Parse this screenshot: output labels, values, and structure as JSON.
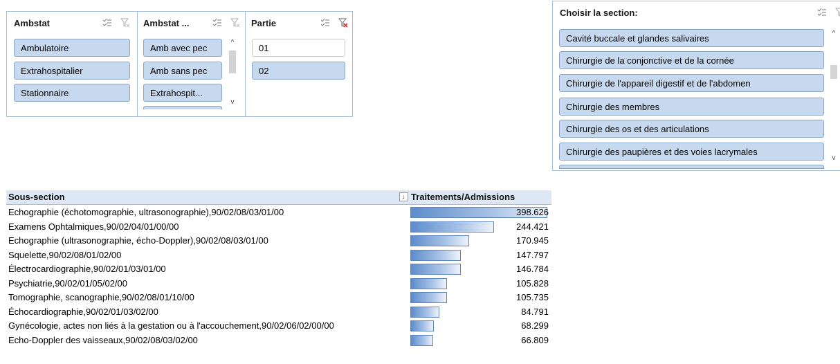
{
  "slicers": {
    "ambstat": {
      "title": "Ambstat",
      "items": [
        "Ambulatoire",
        "Extrahospitalier",
        "Stationnaire"
      ]
    },
    "ambstat2": {
      "title": "Ambstat ...",
      "items": [
        "Amb avec pec",
        "Amb sans pec",
        "Extrahospit..."
      ]
    },
    "partie": {
      "title": "Partie",
      "items": [
        "01",
        "02"
      ]
    },
    "section": {
      "title": "Choisir la section:",
      "items": [
        "Cavité buccale et glandes salivaires",
        "Chirurgie de la conjonctive et de la cornée",
        "Chirurgie de l'appareil digestif et de l'abdomen",
        "Chirurgie des membres",
        "Chirurgie des os et des articulations",
        "Chirurgie des paupières et des voies lacrymales"
      ]
    }
  },
  "table": {
    "col1": "Sous-section",
    "col2": "Traitements/Admissions",
    "sort_icon": "sort-descending-icon",
    "max_value": 398.626,
    "rows": [
      {
        "label": "Echographie (échotomographie, ultrasonographie),90/02/08/03/01/00",
        "value": 398.626,
        "display": "398.626"
      },
      {
        "label": "Examens Ophtalmiques,90/02/04/01/00/00",
        "value": 244.421,
        "display": "244.421"
      },
      {
        "label": "Echographie (ultrasonographie, écho-Doppler),90/02/08/03/01/00",
        "value": 170.945,
        "display": "170.945"
      },
      {
        "label": "Squelette,90/02/08/01/02/00",
        "value": 147.797,
        "display": "147.797"
      },
      {
        "label": "Électrocardiographie,90/02/01/03/01/00",
        "value": 146.784,
        "display": "146.784"
      },
      {
        "label": "Psychiatrie,90/02/01/05/02/00",
        "value": 105.828,
        "display": "105.828"
      },
      {
        "label": "Tomographie, scanographie,90/02/08/01/10/00",
        "value": 105.735,
        "display": "105.735"
      },
      {
        "label": "Échocardiographie,90/02/01/03/02/00",
        "value": 84.791,
        "display": "84.791"
      },
      {
        "label": "Gynécologie, actes non liés à la gestation ou à l'accouchement,90/02/06/02/00/00",
        "value": 68.299,
        "display": "68.299"
      },
      {
        "label": "Echo-Doppler des vaisseaux,90/02/08/03/02/00",
        "value": 66.809,
        "display": "66.809"
      }
    ]
  },
  "colors": {
    "selected_item": "#c6d9ef",
    "border": "#a6bfd8",
    "bar": "#5d8ccb",
    "clear_filter_active": "#e2312d"
  }
}
